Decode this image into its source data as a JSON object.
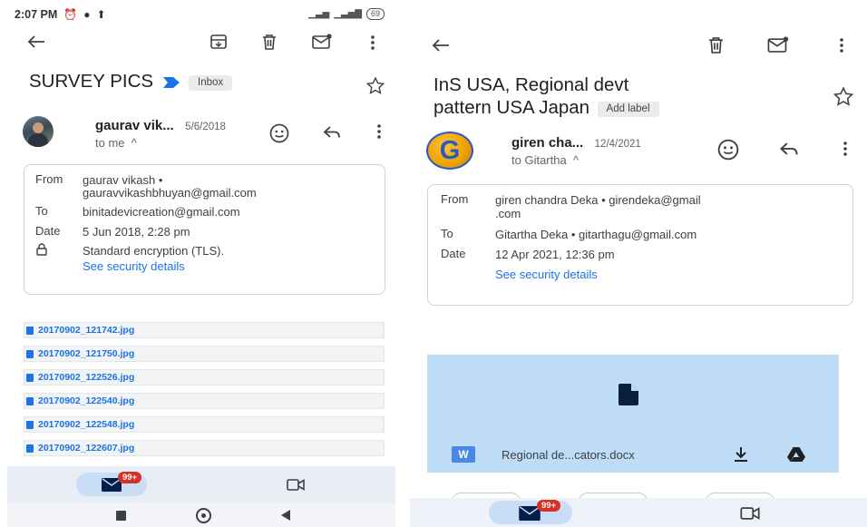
{
  "left": {
    "status": {
      "time": "2:07 PM",
      "battery": "69"
    },
    "subject": "SURVEY PICS",
    "label": "Inbox",
    "sender": {
      "name": "gaurav vik...",
      "date": "5/6/2018",
      "to": "to me"
    },
    "details": {
      "from_label": "From",
      "from_value": "gaurav vikash •",
      "from_email": "gauravvikashbhuyan@gmail.com",
      "to_label": "To",
      "to_value": "binitadevicreation@gmail.com",
      "date_label": "Date",
      "date_value": "5 Jun 2018, 2:28 pm",
      "encryption": "Standard encryption (TLS).",
      "security_link": "See security details"
    },
    "attachments": [
      "20170902_121742.jpg",
      "20170902_121750.jpg",
      "20170902_122526.jpg",
      "20170902_122540.jpg",
      "20170902_122548.jpg",
      "20170902_122607.jpg"
    ],
    "mail_badge": "99+"
  },
  "right": {
    "subject_line1": "InS USA, Regional devt",
    "subject_line2": "pattern USA Japan",
    "label": "Add label",
    "avatar_letter": "G",
    "sender": {
      "name": "giren cha...",
      "date": "12/4/2021",
      "to": "to Gitartha"
    },
    "details": {
      "from_label": "From",
      "from_value": "giren chandra Deka • girendeka@gmail",
      "from_value2": ".com",
      "to_label": "To",
      "to_value": "Gitartha Deka • gitarthagu@gmail.com",
      "date_label": "Date",
      "date_value": "12 Apr 2021, 12:36 pm",
      "security_link": "See security details"
    },
    "attachment": {
      "type_badge": "W",
      "filename": "Regional de...cators.docx"
    },
    "mail_badge": "99+"
  },
  "colors": {
    "accent": "#1a73e8",
    "badge": "#d93025",
    "attachment_bg": "#bfdcf7"
  }
}
